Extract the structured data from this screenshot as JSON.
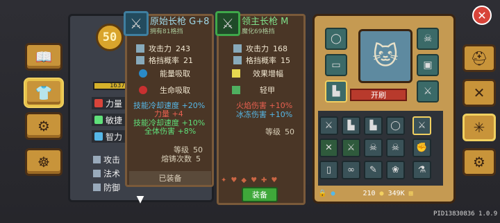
{
  "close_button": {
    "icon": "close-icon"
  },
  "left_nav": [
    {
      "icon": "book-icon"
    },
    {
      "icon": "character-icon"
    },
    {
      "icon": "skills-icon"
    },
    {
      "icon": "steering-wheel-icon"
    }
  ],
  "character": {
    "level": "50",
    "xp_display": "1637",
    "stats": [
      {
        "label": "力量",
        "color": "#d8443a"
      },
      {
        "label": "敏捷",
        "color": "#5fe07a"
      },
      {
        "label": "智力",
        "color": "#56b8e8"
      }
    ],
    "combat": [
      {
        "label": "攻击"
      },
      {
        "label": "法术"
      },
      {
        "label": "防御"
      }
    ]
  },
  "equipped_card": {
    "name": "原始长枪",
    "grade": "G+8",
    "subtitle": "拥有81格挡",
    "attack_label": "攻击力",
    "attack_value": "243",
    "block_label": "格挡概率",
    "block_value": "21",
    "perk1": "能量吸取",
    "perk2": "生命吸取",
    "bonus1": "技能冷却速度 +20%",
    "bonus2": "力量 +4",
    "bonus3": "技能冷却速度 +10%",
    "bonus4": "全体伤害 +8%",
    "level_label": "等级",
    "level_value": "50",
    "reforge_label": "熔铸次数",
    "reforge_value": "5",
    "status": "已装备"
  },
  "compare_card": {
    "name": "领主长枪",
    "grade": "M",
    "subtitle": "魔化69格挡",
    "attack_label": "攻击力",
    "attack_value": "168",
    "block_label": "格挡概率",
    "block_value": "15",
    "perk1": "效果增幅",
    "perk2": "轻甲",
    "bonus1": "火焰伤害 +10%",
    "bonus2": "冰冻伤害 +10%",
    "level_label": "等级",
    "level_value": "50",
    "equip_button": "装备"
  },
  "inventory": {
    "refresh_button": "开刷",
    "gem_count": "210",
    "gold_count": "349K"
  },
  "right_nav": [
    {
      "icon": "helmet-icon"
    },
    {
      "icon": "crossed-swords-icon"
    },
    {
      "icon": "gear-cross-icon"
    },
    {
      "icon": "settings-gear-icon"
    }
  ],
  "pid_label": "PID13830836 1.0.9"
}
